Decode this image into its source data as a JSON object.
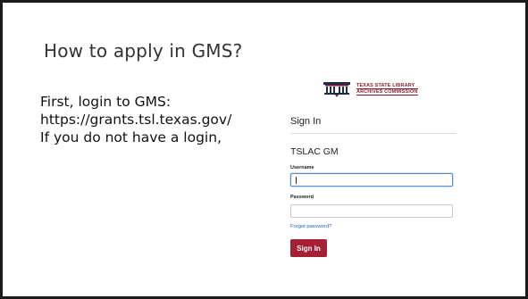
{
  "slide": {
    "title": "How to apply in GMS?",
    "lines": [
      "First, login to GMS:",
      "https://grants.tsl.texas.gov/",
      "If you do not have a login,"
    ]
  },
  "login": {
    "logo_text": [
      "TEXAS STATE LIBRARY",
      "ARCHIVES COMMISSION"
    ],
    "heading": "Sign In",
    "app_name": "TSLAC GM",
    "username_label": "Username",
    "username_value": "",
    "password_label": "Password",
    "password_value": "",
    "forgot_link": "Forgot password?",
    "signin_button": "Sign In"
  },
  "colors": {
    "brand": "#a51f35",
    "link": "#2a5fb0",
    "focus_border": "#5b8fd8"
  }
}
